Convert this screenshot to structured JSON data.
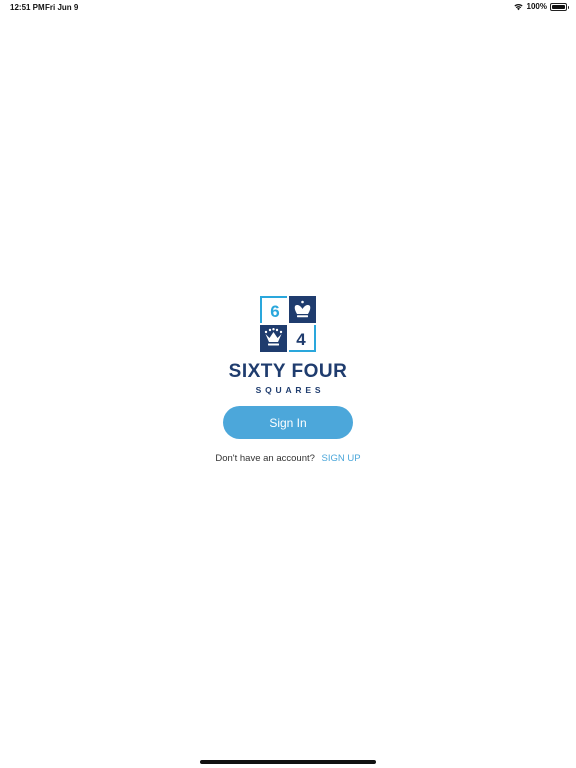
{
  "status_bar": {
    "time": "12:51 PM",
    "date": "Fri Jun 9",
    "battery": "100%",
    "wifi_icon": "wifi-icon",
    "battery_icon": "battery-icon"
  },
  "brand": {
    "logo_digit_top": "6",
    "logo_digit_bottom": "4",
    "title": "SIXTY FOUR",
    "subtitle": "SQUARES",
    "colors": {
      "navy": "#1f3c6e",
      "cyan": "#2aa7dc"
    }
  },
  "auth": {
    "signin_label": "Sign In",
    "signup_prompt": "Don't have an account?",
    "signup_link": "SIGN UP",
    "button_color": "#4ca7da"
  }
}
